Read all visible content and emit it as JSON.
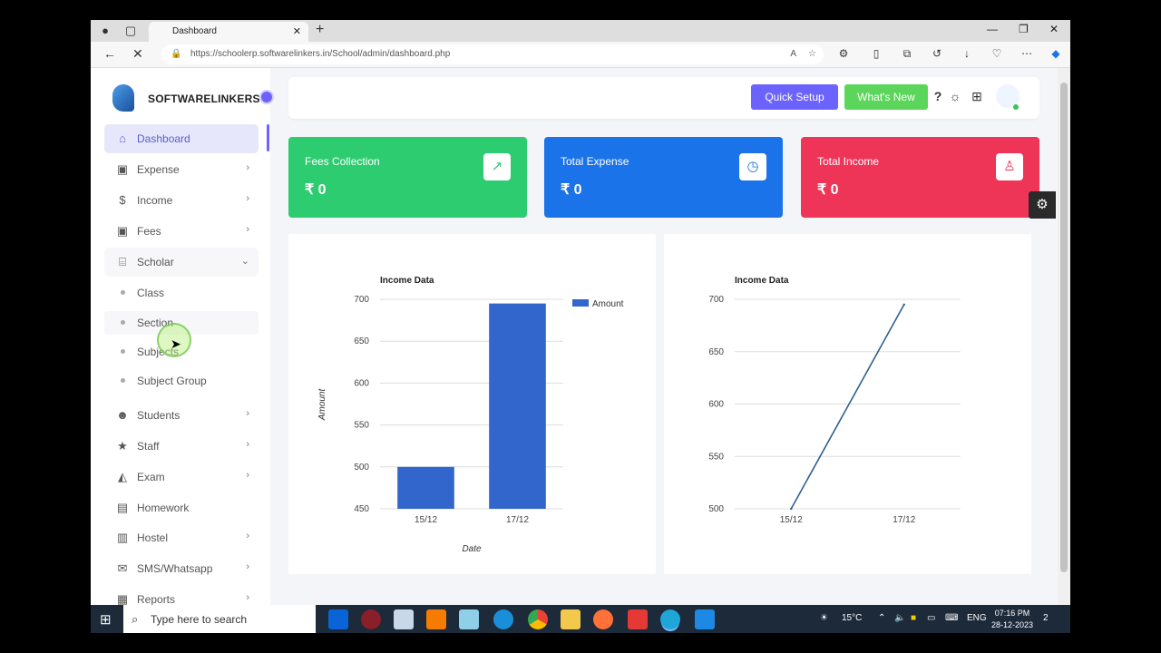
{
  "browser": {
    "tab_title": "Dashboard",
    "url": "https://schoolerp.softwarelinkers.in/School/admin/dashboard.php"
  },
  "brand": {
    "name": "SOFTWARELINKERS"
  },
  "sidebar": {
    "items": [
      {
        "label": "Dashboard",
        "icon": "home-icon",
        "glyph": "⌂"
      },
      {
        "label": "Expense",
        "icon": "money-icon",
        "glyph": "▣"
      },
      {
        "label": "Income",
        "icon": "dollar-icon",
        "glyph": "$"
      },
      {
        "label": "Fees",
        "icon": "money-icon",
        "glyph": "▣"
      },
      {
        "label": "Scholar",
        "icon": "institution-icon",
        "glyph": "⌸"
      },
      {
        "label": "Students",
        "icon": "users-icon",
        "glyph": "☻"
      },
      {
        "label": "Staff",
        "icon": "star-icon",
        "glyph": "★"
      },
      {
        "label": "Exam",
        "icon": "graduation-cap-icon",
        "glyph": "◭"
      },
      {
        "label": "Homework",
        "icon": "book-icon",
        "glyph": "▤"
      },
      {
        "label": "Hostel",
        "icon": "building-icon",
        "glyph": "▥"
      },
      {
        "label": "SMS/Whatsapp",
        "icon": "chat-icon",
        "glyph": "✉"
      },
      {
        "label": "Reports",
        "icon": "file-icon",
        "glyph": "▦"
      }
    ],
    "scholar_sub": [
      "Class",
      "Section",
      "Subjects",
      "Subject Group"
    ]
  },
  "header": {
    "quick_setup": "Quick Setup",
    "whats_new": "What's New"
  },
  "cards": [
    {
      "title": "Fees Collection",
      "value": "₹ 0",
      "color": "#2ecc71",
      "icon": "trending-up-icon",
      "glyph": "↗"
    },
    {
      "title": "Total Expense",
      "value": "₹ 0",
      "color": "#1a73e8",
      "icon": "clock-icon",
      "glyph": "◷"
    },
    {
      "title": "Total Income",
      "value": "₹ 0",
      "color": "#ee3557",
      "icon": "user-icon",
      "glyph": "♙"
    }
  ],
  "chart_data": [
    {
      "type": "bar",
      "title": "Income Data",
      "xlabel": "Date",
      "ylabel": "Amount",
      "categories": [
        "15/12",
        "17/12"
      ],
      "series": [
        {
          "name": "Amount",
          "values": [
            500,
            695
          ],
          "color": "#3366cc"
        }
      ],
      "ylim": [
        450,
        700
      ],
      "yticks": [
        700,
        650,
        600,
        550,
        500,
        450
      ],
      "legend": "right"
    },
    {
      "type": "line",
      "title": "Income Data",
      "categories": [
        "15/12",
        "17/12"
      ],
      "series": [
        {
          "values": [
            500,
            695
          ],
          "color": "#2f5f8f"
        }
      ],
      "ylim": [
        500,
        700
      ],
      "yticks": [
        700,
        650,
        600,
        550,
        500
      ],
      "grid": true
    }
  ],
  "taskbar": {
    "search_placeholder": "Type here to search",
    "weather": "15°C",
    "lang": "ENG",
    "time": "07:16 PM",
    "date": "28-12-2023",
    "notifications": "2"
  }
}
